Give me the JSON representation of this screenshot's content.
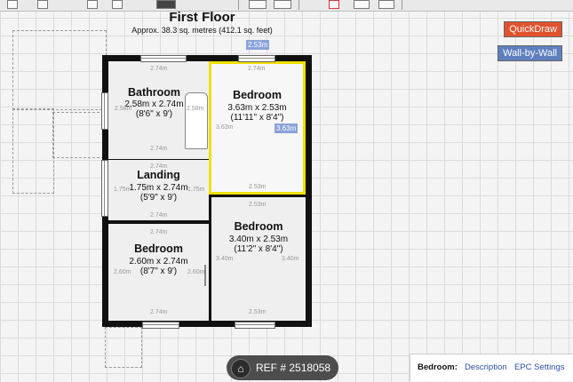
{
  "plan": {
    "title": "First Floor",
    "area": "Approx. 38.3 sq. metres (412.1 sq. feet)"
  },
  "toolbar": {
    "quickdraw_label": "QuickDraw",
    "wall_by_wall_label": "Wall-by-Wall"
  },
  "rooms": {
    "bathroom": {
      "name": "Bathroom",
      "dim_m": "2.58m x 2.74m",
      "dim_ft": "(8'6\" x 9')"
    },
    "bedroom1": {
      "name": "Bedroom",
      "dim_m": "3.63m x 2.53m",
      "dim_ft": "(11'11\" x 8'4\")"
    },
    "landing": {
      "name": "Landing",
      "dim_m": "1.75m x 2.74m",
      "dim_ft": "(5'9\" x 9')"
    },
    "bedroom2": {
      "name": "Bedroom",
      "dim_m": "3.40m x 2.53m",
      "dim_ft": "(11'2\" x 8'4\")"
    },
    "bedroom3": {
      "name": "Bedroom",
      "dim_m": "2.60m x 2.74m",
      "dim_ft": "(8'7\" x 9')"
    }
  },
  "measurements": {
    "m274": "2.74m",
    "m258": "2.58m",
    "m253": "2.53m",
    "m363": "3.63m",
    "m175": "1.75m",
    "m340": "3.40m",
    "m260": "2.60m"
  },
  "selection": {
    "width_tag": "2.53m",
    "height_tag": "3.63m"
  },
  "reference": {
    "home_icon": "home-icon",
    "label": "REF # 2518058"
  },
  "bottom_bar": {
    "label": "Bedroom:",
    "description_link": "Description",
    "epc_link": "EPC Settings"
  }
}
